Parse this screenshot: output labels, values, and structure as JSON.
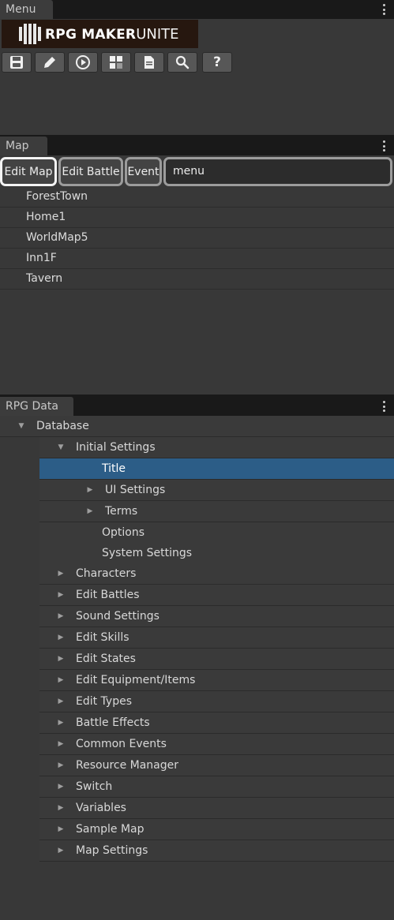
{
  "menu_panel": {
    "tab": "Menu",
    "logo_main": "RPG MAKER",
    "logo_sub": "UNITE",
    "toolbar": [
      {
        "name": "save-icon"
      },
      {
        "name": "edit-pencil-icon"
      },
      {
        "name": "play-icon"
      },
      {
        "name": "addon-blocks-icon"
      },
      {
        "name": "document-icon"
      },
      {
        "name": "search-icon"
      },
      {
        "name": "help-icon",
        "glyph": "?"
      }
    ]
  },
  "map_panel": {
    "tab": "Map",
    "buttons": {
      "edit_map": "Edit Map",
      "edit_battle": "Edit Battle",
      "event": "Event"
    },
    "search_value": "menu",
    "maps": [
      "ForestTown",
      "Home1",
      "WorldMap5",
      "Inn1F",
      "Tavern"
    ]
  },
  "rpg_data_panel": {
    "tab": "RPG Data",
    "root": "Database",
    "initial_settings": {
      "label": "Initial Settings",
      "children": {
        "title": "Title",
        "ui_settings": "UI Settings",
        "terms": "Terms",
        "options": "Options",
        "system_settings": "System Settings"
      }
    },
    "categories": [
      "Characters",
      "Edit Battles",
      "Sound Settings",
      "Edit Skills",
      "Edit States",
      "Edit Equipment/Items",
      "Edit Types",
      "Battle Effects",
      "Common Events",
      "Resource Manager",
      "Switch",
      "Variables",
      "Sample Map",
      "Map Settings"
    ]
  },
  "colors": {
    "panel_bg": "#383838",
    "tab_bar": "#191919",
    "selection": "#2c5d87"
  }
}
